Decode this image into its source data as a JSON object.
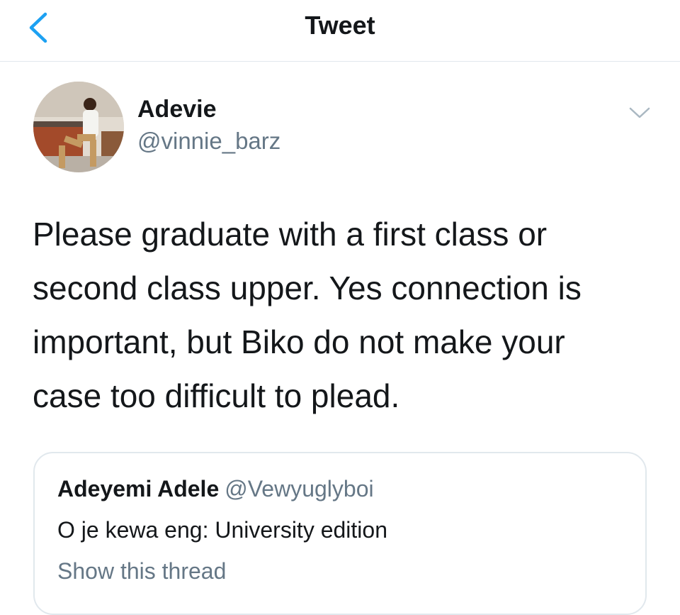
{
  "nav": {
    "title": "Tweet"
  },
  "tweet": {
    "author": {
      "display_name": "Adevie",
      "handle": "@vinnie_barz"
    },
    "text": "Please graduate with a first class or\nsecond class upper. Yes connection is\nimportant, but Biko do not make your\ncase too difficult to plead."
  },
  "quoted_tweet": {
    "display_name": "Adeyemi Adele",
    "handle": "@Vewyuglyboi",
    "text": "O je kewa eng: University edition",
    "show_thread_label": "Show this thread"
  },
  "icons": {
    "back": "chevron-left-icon",
    "more": "chevron-down-icon"
  },
  "colors": {
    "accent": "#1da1f2",
    "text_primary": "#14171a",
    "text_secondary": "#657786",
    "divider": "#e1e8ed"
  }
}
